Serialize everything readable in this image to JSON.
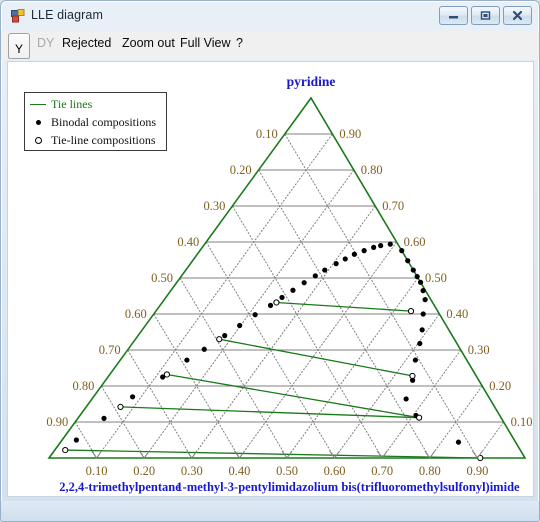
{
  "window": {
    "title": "LLE diagram",
    "icon": "app-window-icon",
    "buttons": [
      {
        "name": "minimize-button",
        "glyph": "minimize-icon"
      },
      {
        "name": "maximize-button",
        "glyph": "maximize-icon"
      },
      {
        "name": "close-button",
        "glyph": "close-icon"
      }
    ]
  },
  "menubar": {
    "toggle_label": "Y",
    "items": [
      {
        "label": "DY",
        "disabled": true
      },
      {
        "label": "Rejected",
        "disabled": false
      },
      {
        "label": "Zoom out",
        "disabled": false
      },
      {
        "label": "Full View",
        "disabled": false
      },
      {
        "label": "?",
        "disabled": false
      }
    ]
  },
  "legend": {
    "entries": [
      {
        "key": "line",
        "label": "Tie lines"
      },
      {
        "key": "dot",
        "label": "Binodal compositions"
      },
      {
        "key": "ring",
        "label": "Tie-line compositions"
      }
    ]
  },
  "colors": {
    "tie_line": "#1a7a1a",
    "triangle_edge": "#1a7a1a",
    "grid": "#808080",
    "tick_label": "#806020",
    "apex_label": "#1818cf",
    "corner_label": "#1818cf",
    "marker": "#000000"
  },
  "chart_data": {
    "type": "scatter",
    "plot_kind": "ternary-phase-diagram",
    "title": "",
    "grid": true,
    "legend_position": "top-left",
    "axes": {
      "top_vertex": {
        "label": "pyridine",
        "component": "pyridine"
      },
      "left_vertex": {
        "label": "2,2,4-trimethylpentane",
        "component": "2,2,4-trimethylpentane"
      },
      "right_vertex": {
        "label": "1-methyl-3-pentylimidazolium bis(trifluoromethylsulfonyl)imide",
        "component": "1-methyl-3-pentylimidazolium bis(trifluoromethylsulfonyl)imide"
      },
      "tick_values": [
        0.1,
        0.2,
        0.3,
        0.4,
        0.5,
        0.6,
        0.7,
        0.8,
        0.9
      ],
      "tick_labels": [
        "0.10",
        "0.20",
        "0.30",
        "0.40",
        "0.50",
        "0.60",
        "0.70",
        "0.80",
        "0.90"
      ],
      "bottom_tick_labels": [
        "0.10",
        "0.20",
        "0.30",
        "0.40",
        "0.50",
        "0.60",
        "0.70",
        "0.80",
        "0.90"
      ],
      "left_tick_labels": [
        "0.10",
        "0.20",
        "0.30",
        "0.40",
        "0.50",
        "0.60",
        "0.70",
        "0.80",
        "0.90"
      ],
      "right_tick_labels": [
        "0.90",
        "0.80",
        "0.70",
        "0.60",
        "0.50",
        "0.40",
        "0.30",
        "0.20",
        "0.10"
      ],
      "range": [
        0.0,
        1.0
      ]
    },
    "binodal_compositions": [
      {
        "a": 0.03,
        "b": 0.05,
        "c": 0.92
      },
      {
        "a": 0.055,
        "b": 0.11,
        "c": 0.835
      },
      {
        "a": 0.082,
        "b": 0.17,
        "c": 0.748
      },
      {
        "a": 0.115,
        "b": 0.225,
        "c": 0.66
      },
      {
        "a": 0.14,
        "b": 0.272,
        "c": 0.588
      },
      {
        "a": 0.16,
        "b": 0.302,
        "c": 0.538
      },
      {
        "a": 0.182,
        "b": 0.34,
        "c": 0.478
      },
      {
        "a": 0.198,
        "b": 0.368,
        "c": 0.434
      },
      {
        "a": 0.214,
        "b": 0.398,
        "c": 0.388
      },
      {
        "a": 0.232,
        "b": 0.424,
        "c": 0.344
      },
      {
        "a": 0.244,
        "b": 0.446,
        "c": 0.31
      },
      {
        "a": 0.256,
        "b": 0.466,
        "c": 0.278
      },
      {
        "a": 0.268,
        "b": 0.487,
        "c": 0.245
      },
      {
        "a": 0.281,
        "b": 0.506,
        "c": 0.213
      },
      {
        "a": 0.292,
        "b": 0.522,
        "c": 0.186
      },
      {
        "a": 0.306,
        "b": 0.54,
        "c": 0.154
      },
      {
        "a": 0.318,
        "b": 0.553,
        "c": 0.129
      },
      {
        "a": 0.33,
        "b": 0.566,
        "c": 0.104
      },
      {
        "a": 0.345,
        "b": 0.576,
        "c": 0.079
      },
      {
        "a": 0.36,
        "b": 0.585,
        "c": 0.055
      },
      {
        "a": 0.372,
        "b": 0.59,
        "c": 0.038
      },
      {
        "a": 0.39,
        "b": 0.594,
        "c": 0.016
      },
      {
        "a": 0.424,
        "b": 0.576,
        "c": 0.0
      },
      {
        "a": 0.452,
        "b": 0.548,
        "c": 0.0
      },
      {
        "a": 0.478,
        "b": 0.522,
        "c": 0.0
      },
      {
        "a": 0.496,
        "b": 0.504,
        "c": 0.0
      },
      {
        "a": 0.512,
        "b": 0.488,
        "c": 0.0
      },
      {
        "a": 0.53,
        "b": 0.465,
        "c": 0.005
      },
      {
        "a": 0.548,
        "b": 0.44,
        "c": 0.012
      },
      {
        "a": 0.566,
        "b": 0.4,
        "c": 0.034
      },
      {
        "a": 0.588,
        "b": 0.356,
        "c": 0.056
      },
      {
        "a": 0.604,
        "b": 0.318,
        "c": 0.078
      },
      {
        "a": 0.62,
        "b": 0.272,
        "c": 0.108
      },
      {
        "a": 0.645,
        "b": 0.216,
        "c": 0.139
      },
      {
        "a": 0.66,
        "b": 0.164,
        "c": 0.176
      },
      {
        "a": 0.706,
        "b": 0.118,
        "c": 0.176
      },
      {
        "a": 0.836,
        "b": 0.044,
        "c": 0.12
      },
      {
        "a": 0.906,
        "b": 0.0,
        "c": 0.094
      }
    ],
    "tie_line_compositions": [
      {
        "a": 0.022,
        "b": 0.022,
        "c": 0.956
      },
      {
        "a": 0.072,
        "b": 0.142,
        "c": 0.786
      },
      {
        "a": 0.12,
        "b": 0.232,
        "c": 0.648
      },
      {
        "a": 0.176,
        "b": 0.33,
        "c": 0.494
      },
      {
        "a": 0.24,
        "b": 0.432,
        "c": 0.328
      },
      {
        "a": 0.536,
        "b": 0.408,
        "c": 0.056
      },
      {
        "a": 0.638,
        "b": 0.228,
        "c": 0.134
      },
      {
        "a": 0.716,
        "b": 0.112,
        "c": 0.172
      },
      {
        "a": 0.906,
        "b": 0.0,
        "c": 0.094
      }
    ],
    "tie_lines": [
      {
        "left": {
          "a": 0.022,
          "b": 0.022,
          "c": 0.956
        },
        "right": {
          "a": 0.906,
          "b": 0.0,
          "c": 0.094
        }
      },
      {
        "left": {
          "a": 0.072,
          "b": 0.142,
          "c": 0.786
        },
        "right": {
          "a": 0.716,
          "b": 0.112,
          "c": 0.172
        }
      },
      {
        "left": {
          "a": 0.12,
          "b": 0.232,
          "c": 0.648
        },
        "right": {
          "a": 0.716,
          "b": 0.112,
          "c": 0.172
        }
      },
      {
        "left": {
          "a": 0.176,
          "b": 0.33,
          "c": 0.494
        },
        "right": {
          "a": 0.638,
          "b": 0.228,
          "c": 0.134
        }
      },
      {
        "left": {
          "a": 0.24,
          "b": 0.432,
          "c": 0.328
        },
        "right": {
          "a": 0.536,
          "b": 0.408,
          "c": 0.056
        }
      }
    ]
  }
}
